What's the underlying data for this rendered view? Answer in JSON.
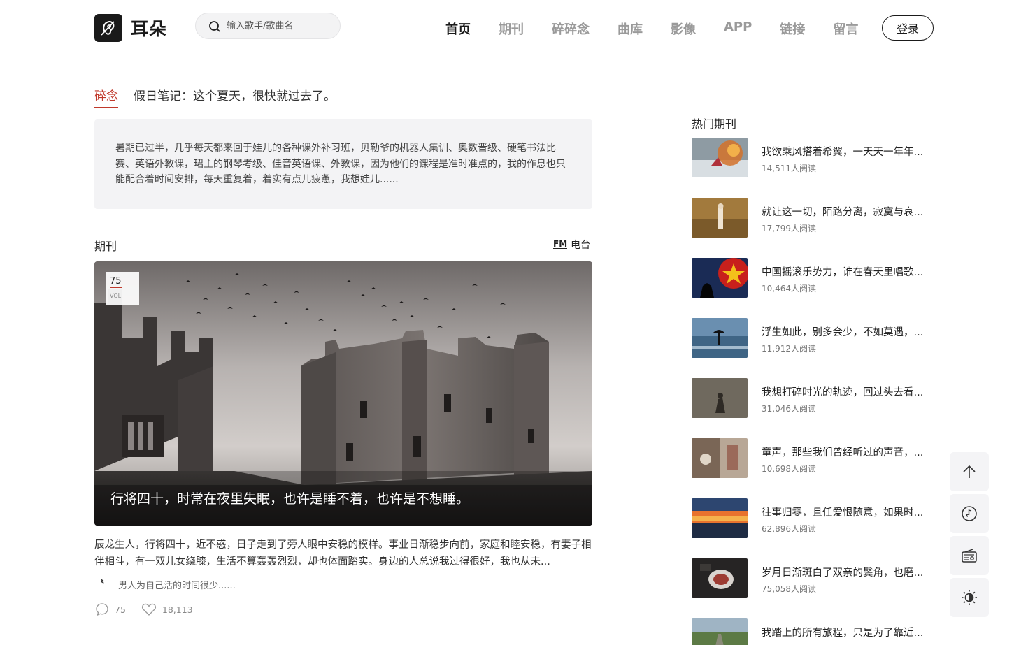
{
  "header": {
    "logo_text": "耳朵",
    "search_placeholder": "输入歌手/歌曲名",
    "nav": [
      "首页",
      "期刊",
      "碎碎念",
      "曲库",
      "影像",
      "APP",
      "链接",
      "留言"
    ],
    "login_label": "登录"
  },
  "note": {
    "tag": "碎念",
    "title": "假日笔记：这个夏天，很快就过去了。",
    "excerpt": "暑期已过半，几乎每天都来回于娃儿的各种课外补习班，贝勒爷的机器人集训、奥数晋级、硬笔书法比赛、英语外教课，珺主的钢琴考级、佳音英语课、外教课，因为他们的课程是准时准点的，我的作息也只能配合着时间安排，每天重复着，着实有点儿疲惫，我想娃儿......"
  },
  "journal": {
    "section_title": "期刊",
    "fm_mark": "FM",
    "fm_label": "电台",
    "vol_number": "75",
    "vol_label": "VOL",
    "cover_caption": "行将四十，时常在夜里失眠，也许是睡不着，也许是不想睡。",
    "description": "辰龙生人，行将四十，近不惑，日子走到了旁人眼中安稳的模样。事业日渐稳步向前，家庭和睦安稳，有妻子相伴相斗，有一双儿女绕膝，生活不算轰轰烈烈，却也体面踏实。身边的人总说我过得很好，我也从未...",
    "quote_mark": "〝",
    "quote": "男人为自己活的时间很少......",
    "comments": "75",
    "likes": "18,113"
  },
  "sidebar": {
    "title": "热门期刊",
    "items": [
      {
        "title": "我欲乘风搭着希翼，一天天一年年...",
        "reads": "14,511人阅读"
      },
      {
        "title": "就让这一切，陌路分离，寂寞与哀...",
        "reads": "17,799人阅读"
      },
      {
        "title": "中国摇滚乐势力，谁在春天里唱歌...",
        "reads": "10,464人阅读"
      },
      {
        "title": "浮生如此，别多会少，不如莫遇，...",
        "reads": "11,912人阅读"
      },
      {
        "title": "我想打碎时光的轨迹，回过头去看...",
        "reads": "31,046人阅读"
      },
      {
        "title": "童声，那些我们曾经听过的声音，...",
        "reads": "10,698人阅读"
      },
      {
        "title": "往事归零，且任爱恨随意，如果时...",
        "reads": "62,896人阅读"
      },
      {
        "title": "岁月日渐斑白了双亲的鬓角，也磨...",
        "reads": "75,058人阅读"
      },
      {
        "title": "我踏上的所有旅程，只是为了靠近...",
        "reads": ""
      }
    ]
  },
  "colors": {
    "accent": "#c0392b",
    "text": "#222222",
    "muted": "#9a9a9a",
    "panel": "#f3f3f5"
  }
}
